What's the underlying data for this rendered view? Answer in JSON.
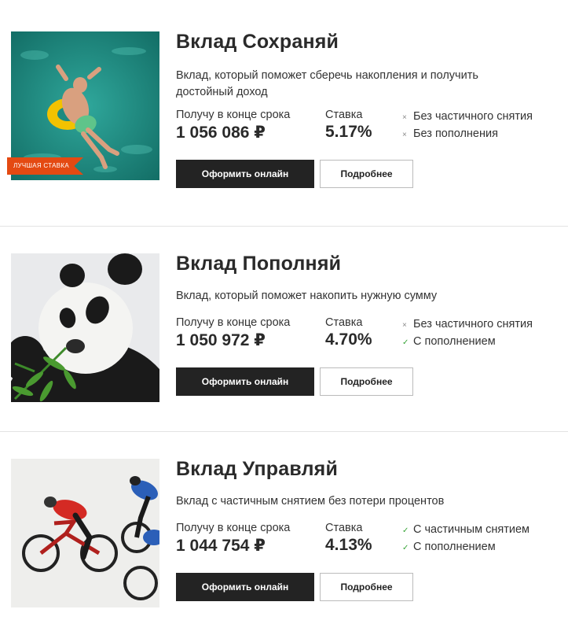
{
  "deposits": [
    {
      "title": "Вклад Сохраняй",
      "description": "Вклад, который поможет сберечь накопления и получить достойный доход",
      "sum_label": "Получу в конце срока",
      "sum_value": "1 056 086 ₽",
      "rate_label": "Ставка",
      "rate_value": "5.17%",
      "badge": "ЛУЧШАЯ СТАВКА",
      "image": "man-floating-on-inflatable-ring",
      "features": [
        {
          "mark": "×",
          "text": "Без частичного снятия",
          "available": false
        },
        {
          "mark": "×",
          "text": "Без пополнения",
          "available": false
        }
      ],
      "apply_label": "Оформить онлайн",
      "details_label": "Подробнее"
    },
    {
      "title": "Вклад Пополняй",
      "description": "Вклад, который поможет накопить нужную сумму",
      "sum_label": "Получу в конце срока",
      "sum_value": "1 050 972 ₽",
      "rate_label": "Ставка",
      "rate_value": "4.70%",
      "image": "panda-eating-bamboo",
      "features": [
        {
          "mark": "×",
          "text": "Без частичного снятия",
          "available": false
        },
        {
          "mark": "✓",
          "text": "С пополнением",
          "available": true
        }
      ],
      "apply_label": "Оформить онлайн",
      "details_label": "Подробнее"
    },
    {
      "title": "Вклад Управляй",
      "description": "Вклад с частичным снятием без потери процентов",
      "sum_label": "Получу в конце срока",
      "sum_value": "1 044 754 ₽",
      "rate_label": "Ставка",
      "rate_value": "4.13%",
      "image": "racing-cyclists",
      "features": [
        {
          "mark": "✓",
          "text": "С частичным снятием",
          "available": true
        },
        {
          "mark": "✓",
          "text": "С пополнением",
          "available": true
        }
      ],
      "apply_label": "Оформить онлайн",
      "details_label": "Подробнее"
    }
  ],
  "colors": {
    "badge": "#e44a12",
    "primary_button": "#232323",
    "check": "#3aa53a",
    "divider": "#e3e3e3"
  }
}
